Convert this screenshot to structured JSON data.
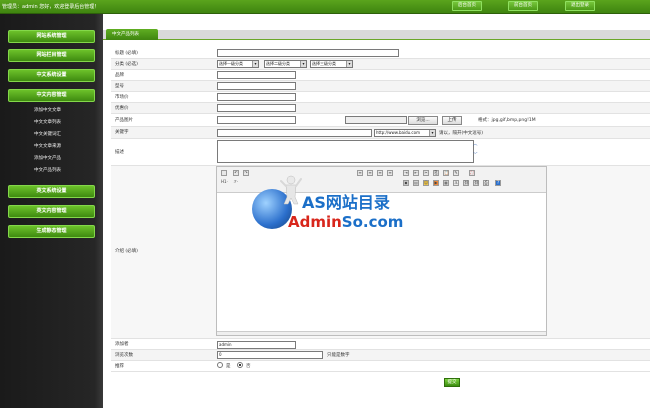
{
  "topbar": {
    "welcome": "管理员：admin 您好，欢迎登录后台管理！",
    "links": [
      "后台首页",
      "前台首页",
      "退出登录"
    ]
  },
  "sidebar": {
    "buttons": [
      "网站系统管理",
      "网站栏目管理",
      "中文系统设置",
      "中文内容管理"
    ],
    "subitems": [
      "添加中文文章",
      "中文文章列表",
      "中文关键词汇",
      "中文文章来源",
      "添加中文产品",
      "中文产品列表"
    ],
    "buttons2": [
      "英文系统设置",
      "英文内容管理",
      "生成静态管理"
    ]
  },
  "tab": {
    "label": "中文产品列表"
  },
  "form": {
    "title_label": "标题 (必填)",
    "category_label": "分类 (必选)",
    "cat1": "选择一级分类",
    "cat2": "选择二级分类",
    "cat3": "选择三级分类",
    "brand_label": "品牌",
    "model_label": "型号",
    "market_price_label": "市场价",
    "sale_price_label": "优惠价",
    "image_label": "产品图片",
    "browse_label": "浏览...",
    "upload_label": "上传",
    "format_hint": "格式：jpg,gif,bmp,png!1M",
    "keywords_label": "关键字",
    "keywords_select": "http://www.baidu.com",
    "keywords_hint": "请以，隔开(中文逗号)",
    "desc_label": "描述",
    "intro_label": "介绍 (必填)",
    "author_label": "添加者",
    "author_value": "admin",
    "views_label": "浏览次数",
    "views_value": "0",
    "views_hint": "只能是数字",
    "recommend_label": "推荐",
    "radio_no": "是",
    "radio_yes": "否",
    "submit_label": "提交"
  },
  "watermark": {
    "line1": "AS网站目录",
    "line2_red": "Admin",
    "line2_blue": "So.com"
  },
  "colors": {
    "accent": "#4a9a16",
    "sidebar": "#222222",
    "wm_blue": "#1b6fc8",
    "wm_red": "#d8261b"
  }
}
